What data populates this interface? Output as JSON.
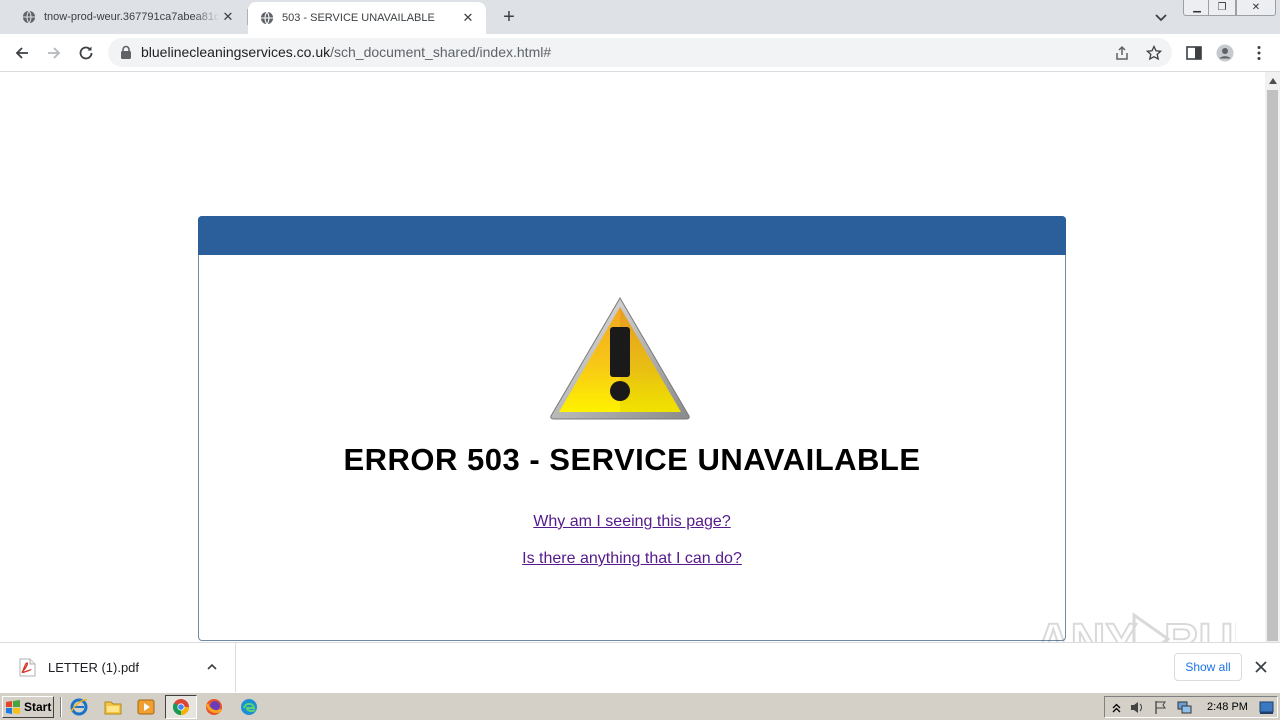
{
  "browser": {
    "tabs": [
      {
        "title": "tnow-prod-weur.367791ca7abea81c",
        "active": false
      },
      {
        "title": "503 - SERVICE UNAVAILABLE",
        "active": true
      }
    ],
    "url_domain": "bluelinecleaningservices.co.uk",
    "url_path": "/sch_document_shared/index.html#"
  },
  "page": {
    "error_title": "ERROR 503 - SERVICE UNAVAILABLE",
    "link_why": "Why am I seeing this page?",
    "link_what": "Is there anything that I can do?",
    "header_color": "#2b5f9b",
    "link_color": "#551a8b"
  },
  "watermark": {
    "text": "ANY RUN"
  },
  "downloads": {
    "file_name": "LETTER (1).pdf",
    "show_all_label": "Show all"
  },
  "taskbar": {
    "start_label": "Start",
    "clock": "2:48 PM"
  },
  "icons": {
    "tab_favicon": "globe-icon",
    "page_icon": "warning-triangle-icon",
    "download_file_icon": "pdf-file-icon"
  }
}
